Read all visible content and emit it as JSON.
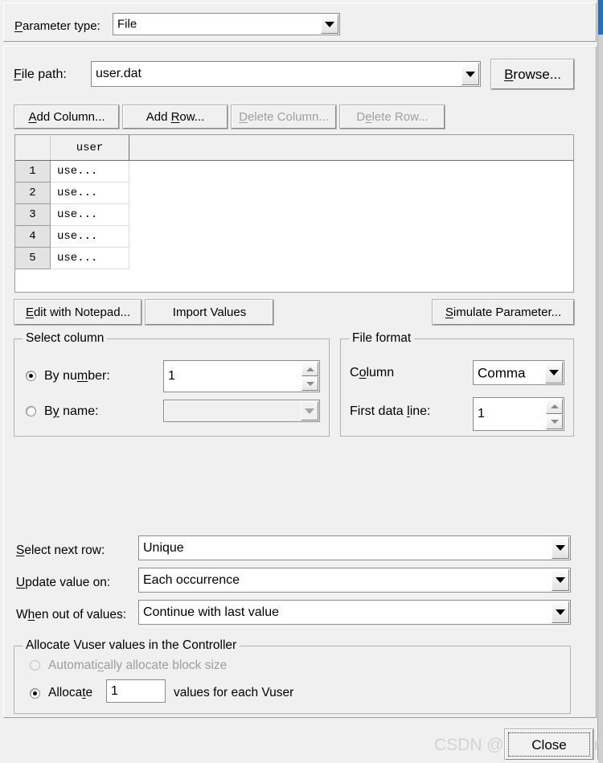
{
  "dialog": {
    "parameter_type": {
      "label": "Parameter type:",
      "value": "File"
    },
    "file_path": {
      "label": "File path:",
      "value": "user.dat",
      "browse_label": "Browse..."
    },
    "table_toolbar": {
      "add_column": "Add Column...",
      "add_row": "Add Row...",
      "delete_column": "Delete Column...",
      "delete_row": "Delete Row..."
    },
    "table": {
      "columns": [
        "user"
      ],
      "row_numbers": [
        "1",
        "2",
        "3",
        "4",
        "5"
      ],
      "rows": [
        [
          "use..."
        ],
        [
          "use..."
        ],
        [
          "use..."
        ],
        [
          "use..."
        ],
        [
          "use..."
        ]
      ]
    },
    "table_actions": {
      "edit_with_notepad": "Edit with Notepad...",
      "import_values": "Import Values",
      "simulate_parameter": "Simulate Parameter..."
    },
    "select_column": {
      "title": "Select column",
      "by_number_label": "By number:",
      "by_number_value": "1",
      "by_number_selected": true,
      "by_name_label": "By name:",
      "by_name_value": "",
      "by_name_selected": false
    },
    "file_format": {
      "title": "File format",
      "column_label": "Column",
      "column_value": "Comma",
      "first_data_line_label": "First data line:",
      "first_data_line_value": "1"
    },
    "select_next_row": {
      "label": "Select next row:",
      "value": "Unique"
    },
    "update_value_on": {
      "label": "Update value on:",
      "value": "Each occurrence"
    },
    "when_out_of_values": {
      "label": "When out of values:",
      "value": "Continue with last value"
    },
    "allocate_group": {
      "title": "Allocate Vuser values in the Controller",
      "auto_label": "Automatically allocate block size",
      "auto_selected": false,
      "auto_disabled": true,
      "allocate_label": "Allocate",
      "allocate_value": "1",
      "allocate_suffix": "values for each Vuser",
      "allocate_selected": true
    },
    "close_button": "Close",
    "watermark": "CSDN @Java the world",
    "colors": {
      "dialog_background": "#f0f0f0",
      "field_background": "#ffffff",
      "disabled_text": "#a0a0a0",
      "accent_strip": "#2670b8",
      "border": "#9c9c9c"
    }
  }
}
